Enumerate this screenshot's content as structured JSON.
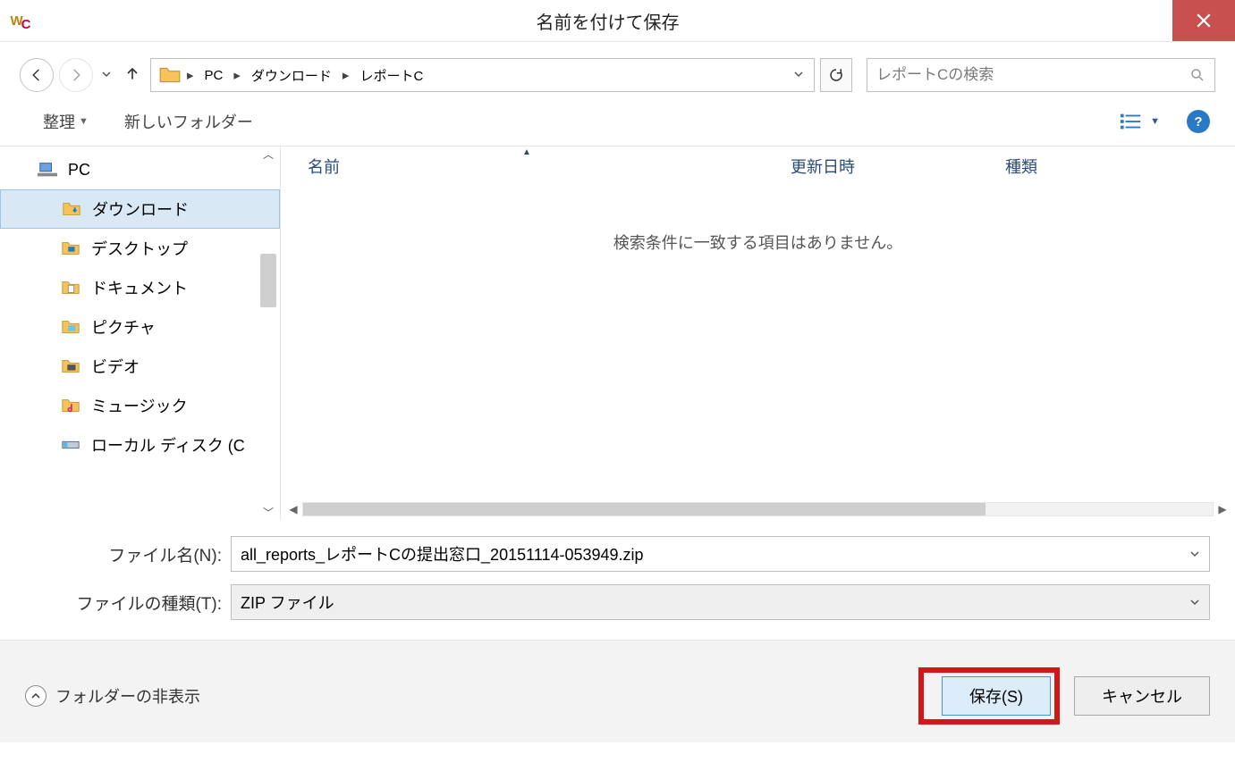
{
  "title": "名前を付けて保存",
  "breadcrumbs": [
    "PC",
    "ダウンロード",
    "レポートC"
  ],
  "search": {
    "placeholder": "レポートCの検索"
  },
  "toolbar": {
    "organize": "整理",
    "newFolder": "新しいフォルダー"
  },
  "tree": {
    "root": "PC",
    "items": [
      "ダウンロード",
      "デスクトップ",
      "ドキュメント",
      "ピクチャ",
      "ビデオ",
      "ミュージック",
      "ローカル ディスク (C"
    ],
    "selectedIndex": 0
  },
  "columns": {
    "name": "名前",
    "modified": "更新日時",
    "type": "種類"
  },
  "emptyMessage": "検索条件に一致する項目はありません。",
  "fields": {
    "filenameLabel": "ファイル名(N):",
    "filenameValue": "all_reports_レポートCの提出窓口_20151114-053949.zip",
    "filetypeLabel": "ファイルの種類(T):",
    "filetypeValue": "ZIP ファイル"
  },
  "footer": {
    "hideFolders": "フォルダーの非表示",
    "save": "保存(S)",
    "cancel": "キャンセル"
  }
}
